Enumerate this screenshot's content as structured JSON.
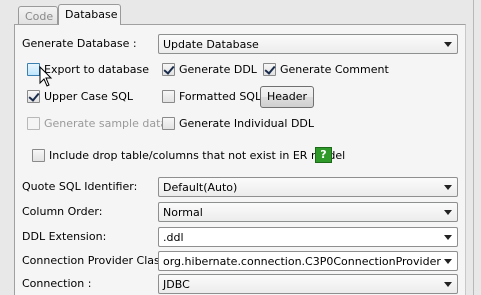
{
  "tabs": [
    {
      "label": "Code",
      "active": false
    },
    {
      "label": "Database",
      "active": true
    }
  ],
  "fields": {
    "generate_database": {
      "label": "Generate Database :",
      "value": "Update Database"
    },
    "quote_sql_identifier": {
      "label": "Quote SQL Identifier:",
      "value": "Default(Auto)"
    },
    "column_order": {
      "label": "Column Order:",
      "value": "Normal"
    },
    "ddl_extension": {
      "label": "DDL Extension:",
      "value": ".ddl"
    },
    "connection_provider_class": {
      "label": "Connection Provider Class:",
      "value": "org.hibernate.connection.C3P0ConnectionProvider"
    },
    "connection": {
      "label": "Connection :",
      "value": "JDBC"
    }
  },
  "checkboxes": {
    "export_to_database": {
      "label": "Export to database",
      "checked": false,
      "enabled": true
    },
    "generate_ddl": {
      "label": "Generate DDL",
      "checked": true,
      "enabled": true
    },
    "generate_comment": {
      "label": "Generate Comment",
      "checked": true,
      "enabled": true
    },
    "upper_case_sql": {
      "label": "Upper Case SQL",
      "checked": true,
      "enabled": true
    },
    "formatted_sql": {
      "label": "Formatted SQL",
      "checked": false,
      "enabled": true
    },
    "generate_sample_data": {
      "label": "Generate sample data",
      "checked": false,
      "enabled": false
    },
    "generate_individual_ddl": {
      "label": "Generate Individual DDL",
      "checked": false,
      "enabled": true
    },
    "include_drop_table": {
      "label": "Include drop table/columns that not exist in ER model",
      "checked": false,
      "enabled": true
    }
  },
  "buttons": {
    "header": "Header",
    "help": "?"
  },
  "icons": {
    "help": "help-question-icon",
    "cursor": "mouse-pointer-icon",
    "dropdown": "chevron-down-icon"
  },
  "colors": {
    "help_icon_bg": "#2f9a2a",
    "panel_bg": "#f5f5f5",
    "window_bg": "#e8e8e8"
  }
}
